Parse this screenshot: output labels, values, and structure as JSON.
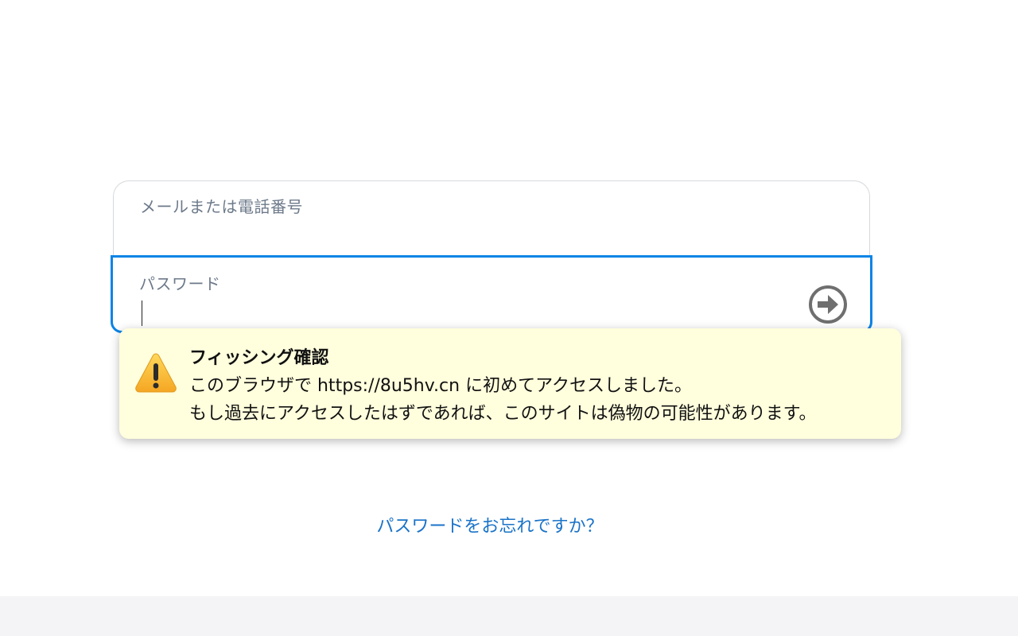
{
  "login": {
    "email_label": "メールまたは電話番号",
    "email_value": "",
    "password_label": "パスワード",
    "password_value": ""
  },
  "phishing_popup": {
    "title": "フィッシング確認",
    "line1": "このブラウザで https://8u5hv.cn に初めてアクセスしました。",
    "line2": "もし過去にアクセスしたはずであれば、このサイトは偽物の可能性があります。",
    "icon": "warning-triangle-icon"
  },
  "forgot_password_link": "パスワードをお忘れですか？",
  "colors": {
    "focus_border": "#0a84e6",
    "popup_background": "#fffedd",
    "link": "#1a73c8",
    "label": "#6d7a8a"
  }
}
